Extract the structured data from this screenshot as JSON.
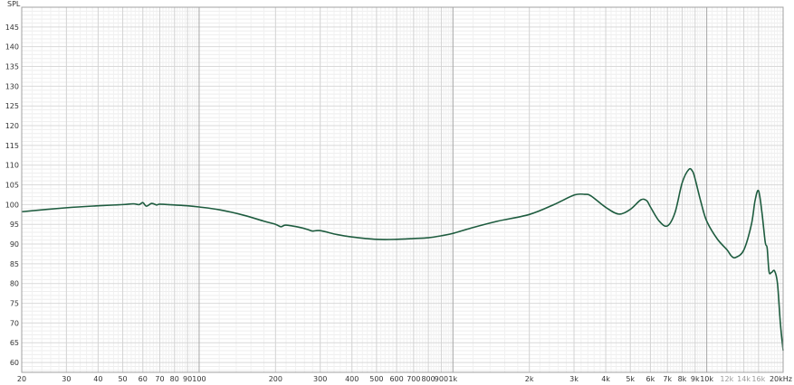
{
  "chart_data": {
    "type": "line",
    "ylabel": "SPL",
    "xlabel": "",
    "x_scale": "log",
    "xlim": [
      20,
      20000
    ],
    "ylim": [
      57.5,
      150
    ],
    "grid": true,
    "x_ticks": [
      {
        "value": 20,
        "label": "20"
      },
      {
        "value": 30,
        "label": "30"
      },
      {
        "value": 40,
        "label": "40"
      },
      {
        "value": 50,
        "label": "50"
      },
      {
        "value": 60,
        "label": "60"
      },
      {
        "value": 70,
        "label": "70"
      },
      {
        "value": 80,
        "label": "80"
      },
      {
        "value": 90,
        "label": "90"
      },
      {
        "value": 100,
        "label": "100"
      },
      {
        "value": 200,
        "label": "200"
      },
      {
        "value": 300,
        "label": "300"
      },
      {
        "value": 400,
        "label": "400"
      },
      {
        "value": 500,
        "label": "500"
      },
      {
        "value": 600,
        "label": "600"
      },
      {
        "value": 700,
        "label": "700"
      },
      {
        "value": 800,
        "label": "800"
      },
      {
        "value": 900,
        "label": "900"
      },
      {
        "value": 1000,
        "label": "1k"
      },
      {
        "value": 2000,
        "label": "2k"
      },
      {
        "value": 3000,
        "label": "3k"
      },
      {
        "value": 4000,
        "label": "4k"
      },
      {
        "value": 5000,
        "label": "5k"
      },
      {
        "value": 6000,
        "label": "6k"
      },
      {
        "value": 7000,
        "label": "7k"
      },
      {
        "value": 8000,
        "label": "8k"
      },
      {
        "value": 9000,
        "label": "9k"
      },
      {
        "value": 10000,
        "label": "10k"
      },
      {
        "value": 12000,
        "label": "12k"
      },
      {
        "value": 14000,
        "label": "14k"
      },
      {
        "value": 16000,
        "label": "16k"
      },
      {
        "value": 20000,
        "label": "20kHz"
      }
    ],
    "dim_tick_labels": [
      "12k",
      "14k",
      "16k"
    ],
    "y_ticks": [
      60,
      65,
      70,
      75,
      80,
      85,
      90,
      95,
      100,
      105,
      110,
      115,
      120,
      125,
      130,
      135,
      140,
      145
    ],
    "series": [
      {
        "color": "#1e5c3f",
        "x": [
          20,
          30,
          40,
          50,
          55,
          58,
          60,
          62,
          65,
          68,
          70,
          80,
          90,
          100,
          120,
          150,
          180,
          200,
          210,
          220,
          250,
          270,
          280,
          300,
          350,
          400,
          500,
          600,
          700,
          800,
          900,
          1000,
          1200,
          1500,
          2000,
          2500,
          3000,
          3300,
          3500,
          4000,
          4500,
          5000,
          5500,
          5800,
          6000,
          6500,
          7000,
          7500,
          8000,
          8500,
          8800,
          9000,
          9500,
          10000,
          11000,
          12000,
          12500,
          13000,
          14000,
          15000,
          15500,
          16000,
          16500,
          17000,
          17300,
          17600,
          18000,
          18500,
          19000,
          19500,
          20000
        ],
        "y": [
          98.2,
          99.2,
          99.7,
          100.0,
          100.2,
          100.0,
          100.5,
          99.6,
          100.3,
          99.9,
          100.1,
          99.9,
          99.7,
          99.4,
          98.7,
          97.3,
          95.8,
          95.0,
          94.4,
          94.8,
          94.2,
          93.6,
          93.3,
          93.4,
          92.4,
          91.8,
          91.2,
          91.2,
          91.4,
          91.6,
          92.1,
          92.7,
          94.2,
          95.8,
          97.5,
          100.0,
          102.4,
          102.6,
          102.2,
          99.3,
          97.6,
          98.8,
          101.2,
          101.0,
          99.4,
          95.8,
          94.6,
          98.0,
          105.5,
          108.9,
          108.4,
          106.5,
          100.5,
          95.8,
          91.3,
          88.6,
          87.0,
          86.6,
          88.5,
          95.0,
          101.0,
          103.5,
          98.0,
          90.5,
          89.0,
          83.0,
          82.8,
          83.2,
          80.0,
          70.0,
          63.0
        ]
      }
    ]
  }
}
